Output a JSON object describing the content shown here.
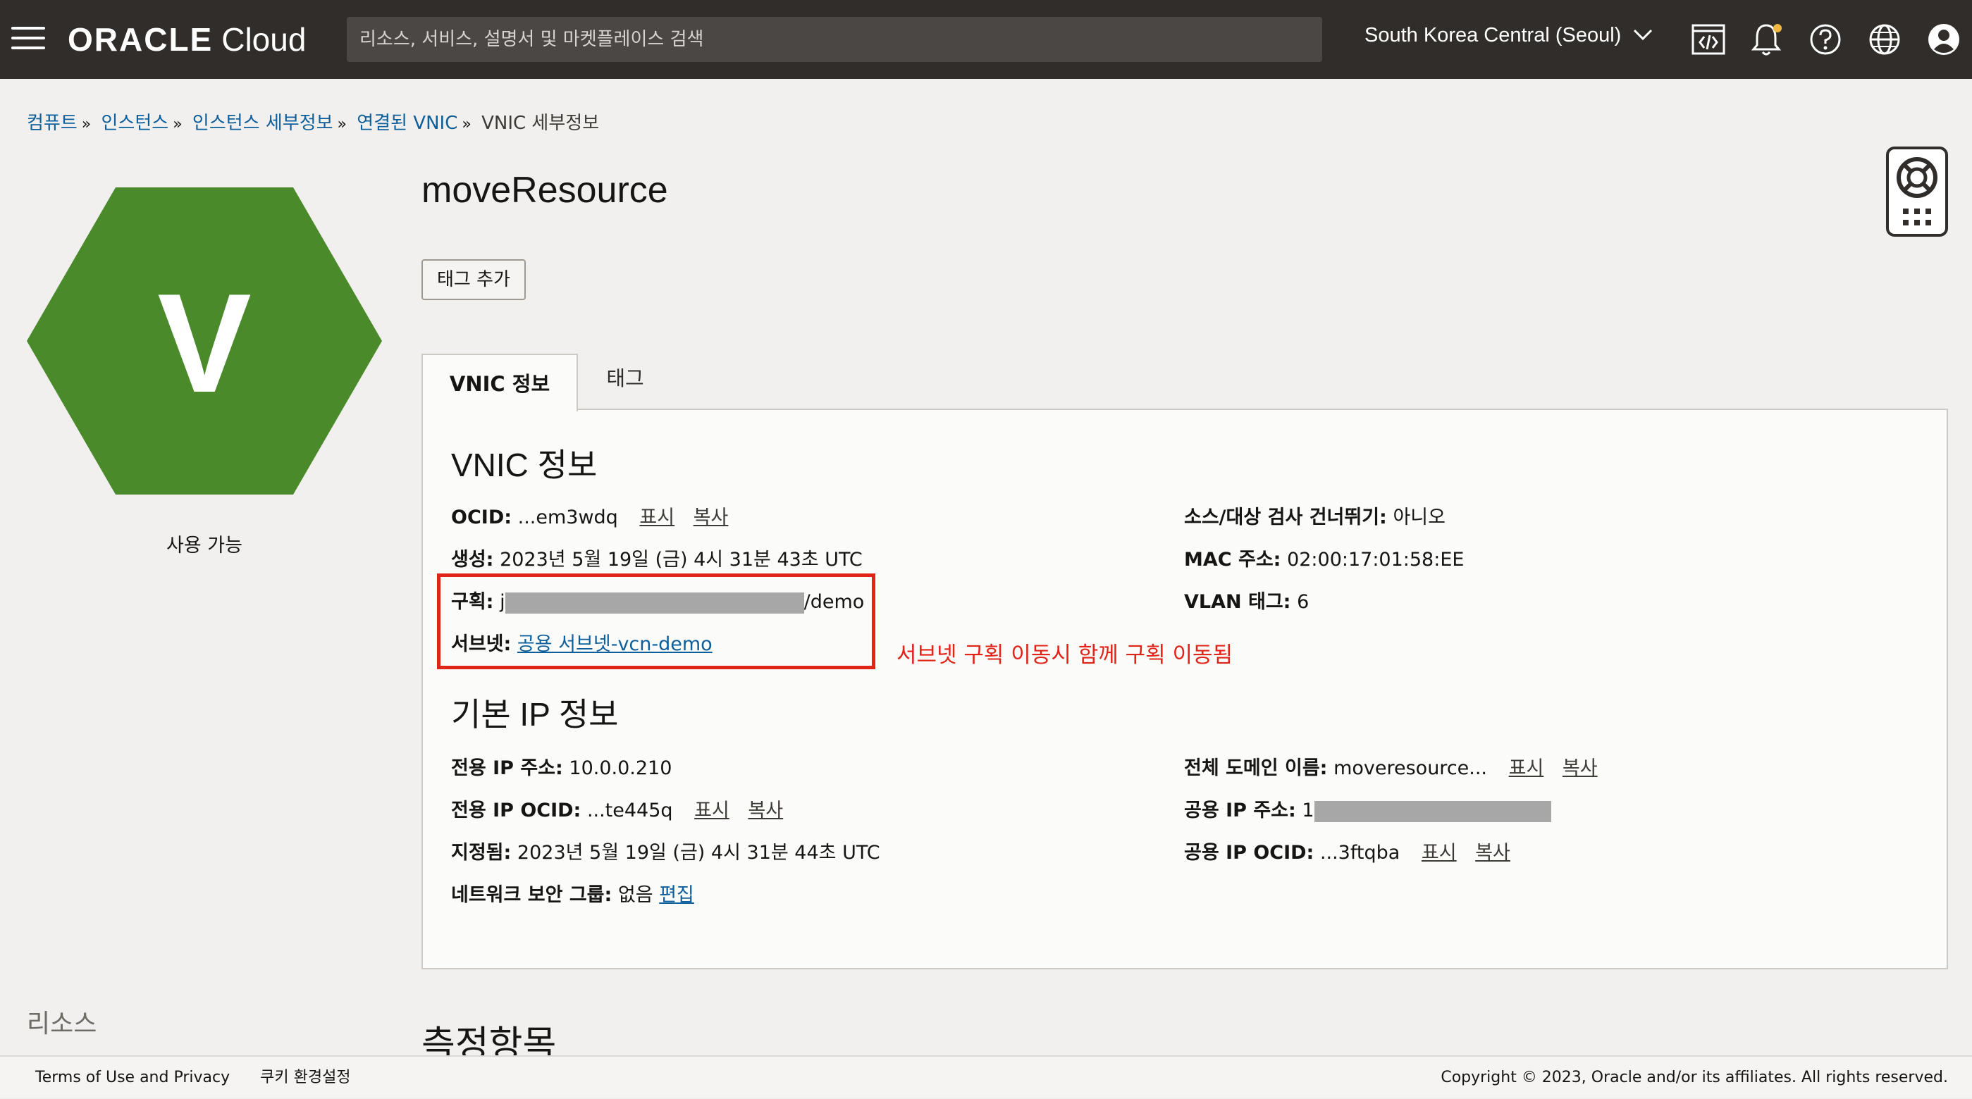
{
  "header": {
    "brand": "ORACLE",
    "brand_suffix": "Cloud",
    "search_placeholder": "리소스, 서비스, 설명서 및 마켓플레이스 검색",
    "region": "South Korea Central (Seoul)",
    "icons": [
      "menu-icon",
      "cloud-shell-icon",
      "bell-icon",
      "help-icon",
      "globe-icon",
      "user-icon"
    ]
  },
  "breadcrumb": {
    "items": [
      "컴퓨트",
      "인스턴스",
      "인스턴스 세부정보",
      "연결된 VNIC"
    ],
    "current": "VNIC 세부정보",
    "separator": "»"
  },
  "sidebar": {
    "avatar_letter": "V",
    "status": "사용 가능",
    "resources_label": "리소스",
    "status_color": "#4a8a2a"
  },
  "main": {
    "title": "moveResource",
    "add_tag_button": "태그 추가",
    "tabs": [
      "VNIC 정보",
      "태그"
    ],
    "vnic_section": {
      "heading": "VNIC 정보",
      "left": {
        "ocid_label": "OCID:",
        "ocid_value": "...em3wdq",
        "show": "표시",
        "copy": "복사",
        "created_label": "생성:",
        "created_value": "2023년 5월 19일 (금) 4시 31분 43초 UTC",
        "compartment_label": "구획:",
        "compartment_prefix": "j",
        "compartment_suffix": "/demo",
        "subnet_label": "서브넷:",
        "subnet_value": "공용 서브넷-vcn-demo"
      },
      "right": {
        "skip_check_label": "소스/대상 검사 건너뛰기:",
        "skip_check_value": "아니오",
        "mac_label": "MAC 주소:",
        "mac_value": "02:00:17:01:58:EE",
        "vlan_label": "VLAN 태그:",
        "vlan_value": "6"
      }
    },
    "annotation": "서브넷 구획 이동시 함께 구획 이동됨",
    "ip_section": {
      "heading": "기본 IP 정보",
      "left": {
        "private_ip_label": "전용 IP 주소:",
        "private_ip_value": "10.0.0.210",
        "private_ocid_label": "전용 IP OCID:",
        "private_ocid_value": "...te445q",
        "show": "표시",
        "copy": "복사",
        "assigned_label": "지정됨:",
        "assigned_value": "2023년 5월 19일 (금) 4시 31분 44초 UTC",
        "nsg_label": "네트워크 보안 그룹:",
        "nsg_value": "없음",
        "edit": "편집"
      },
      "right": {
        "fqdn_label": "전체 도메인 이름:",
        "fqdn_value": "moveresource...",
        "show": "표시",
        "copy": "복사",
        "public_ip_label": "공용 IP 주소:",
        "public_ip_prefix": "1",
        "public_ocid_label": "공용 IP OCID:",
        "public_ocid_value": "...3ftqba"
      }
    },
    "metrics_heading": "측정항목"
  },
  "footer": {
    "terms": "Terms of Use and Privacy",
    "cookies": "쿠키 환경설정",
    "copyright": "Copyright © 2023, Oracle and/or its affiliates. All rights reserved."
  }
}
